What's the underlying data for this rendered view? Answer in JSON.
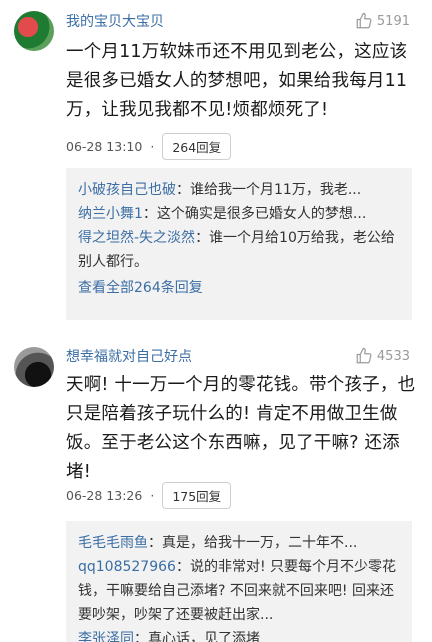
{
  "comments": [
    {
      "username": "我的宝贝大宝贝",
      "likes": "5191",
      "text": "一个月11万软妹币还不用见到老公，这应该是很多已婚女人的梦想吧，如果给我每月11万，让我见我都不见!烦都烦死了!",
      "time": "06-28 13:10",
      "dot": "·",
      "reply_btn": "264回复",
      "replies": [
        {
          "name": "小破孩自己也破",
          "text": "：谁给我一个月11万，我老..."
        },
        {
          "name": "纳兰小舞1",
          "text": "：这个确实是很多已婚女人的梦想..."
        },
        {
          "name": "得之坦然-失之淡然",
          "text": "：谁一个月给10万给我，老公给别人都行。"
        }
      ],
      "view_all": "查看全部264条回复"
    },
    {
      "username": "想幸福就对自己好点",
      "likes": "4533",
      "text": "天啊! 十一万一个月的零花钱。带个孩子，也只是陪着孩子玩什么的! 肯定不用做卫生做饭。至于老公这个东西嘛，见了干嘛? 还添堵!",
      "time": "06-28 13:26",
      "dot": "·",
      "reply_btn": "175回复",
      "replies": [
        {
          "name": "毛毛毛雨鱼",
          "text": "：真是，给我十一万，二十年不..."
        },
        {
          "name": "qq108527966",
          "text": "：说的非常对! 只要每个月不少零花钱，干嘛要给自己添堵? 不回来就不回来吧! 回来还要吵架，吵架了还要被赶出家..."
        },
        {
          "name": "李张泽同",
          "text": "：真心话，见了添堵"
        }
      ]
    }
  ],
  "icons": {
    "like": "thumbs-up-icon"
  }
}
